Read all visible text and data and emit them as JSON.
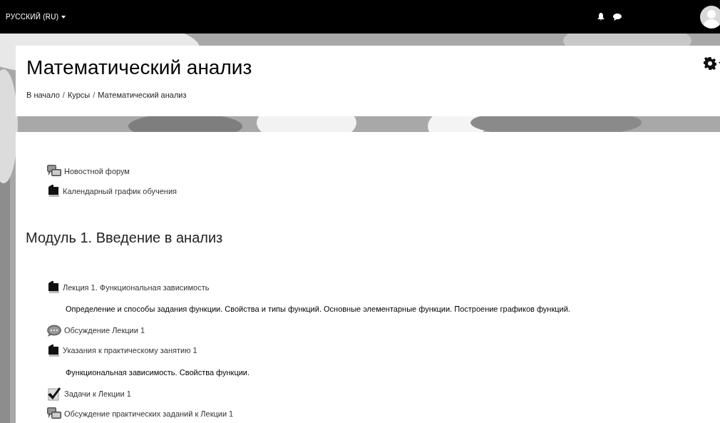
{
  "navbar": {
    "language": "РУССКИЙ (RU)"
  },
  "header": {
    "title": "Математический анализ",
    "breadcrumb": [
      "В начало",
      "Курсы",
      "Математический анализ"
    ],
    "separator": "/"
  },
  "intro_items": [
    {
      "kind": "forum",
      "label": "Новостной форум"
    },
    {
      "kind": "resource",
      "label": "Календарный график обучения"
    }
  ],
  "section": {
    "title": "Модуль 1. Введение в анализ",
    "items": [
      {
        "kind": "resource",
        "label": "Лекция 1. Функциональная зависимость"
      },
      {
        "kind": "description",
        "label": "Определение и способы задания функции. Свойства и типы функций. Основные элементарные функции. Построение графиков функций."
      },
      {
        "kind": "chat",
        "label": "Обсуждение Лекции 1"
      },
      {
        "kind": "resource",
        "label": "Указания к практическому занятию 1"
      },
      {
        "kind": "description",
        "label": "Функциональная зависимость. Свойства функции."
      },
      {
        "kind": "assign",
        "label": "Задачи к Лекции 1"
      },
      {
        "kind": "forum",
        "label": "Обсуждение практических заданий к Лекции 1"
      }
    ]
  }
}
